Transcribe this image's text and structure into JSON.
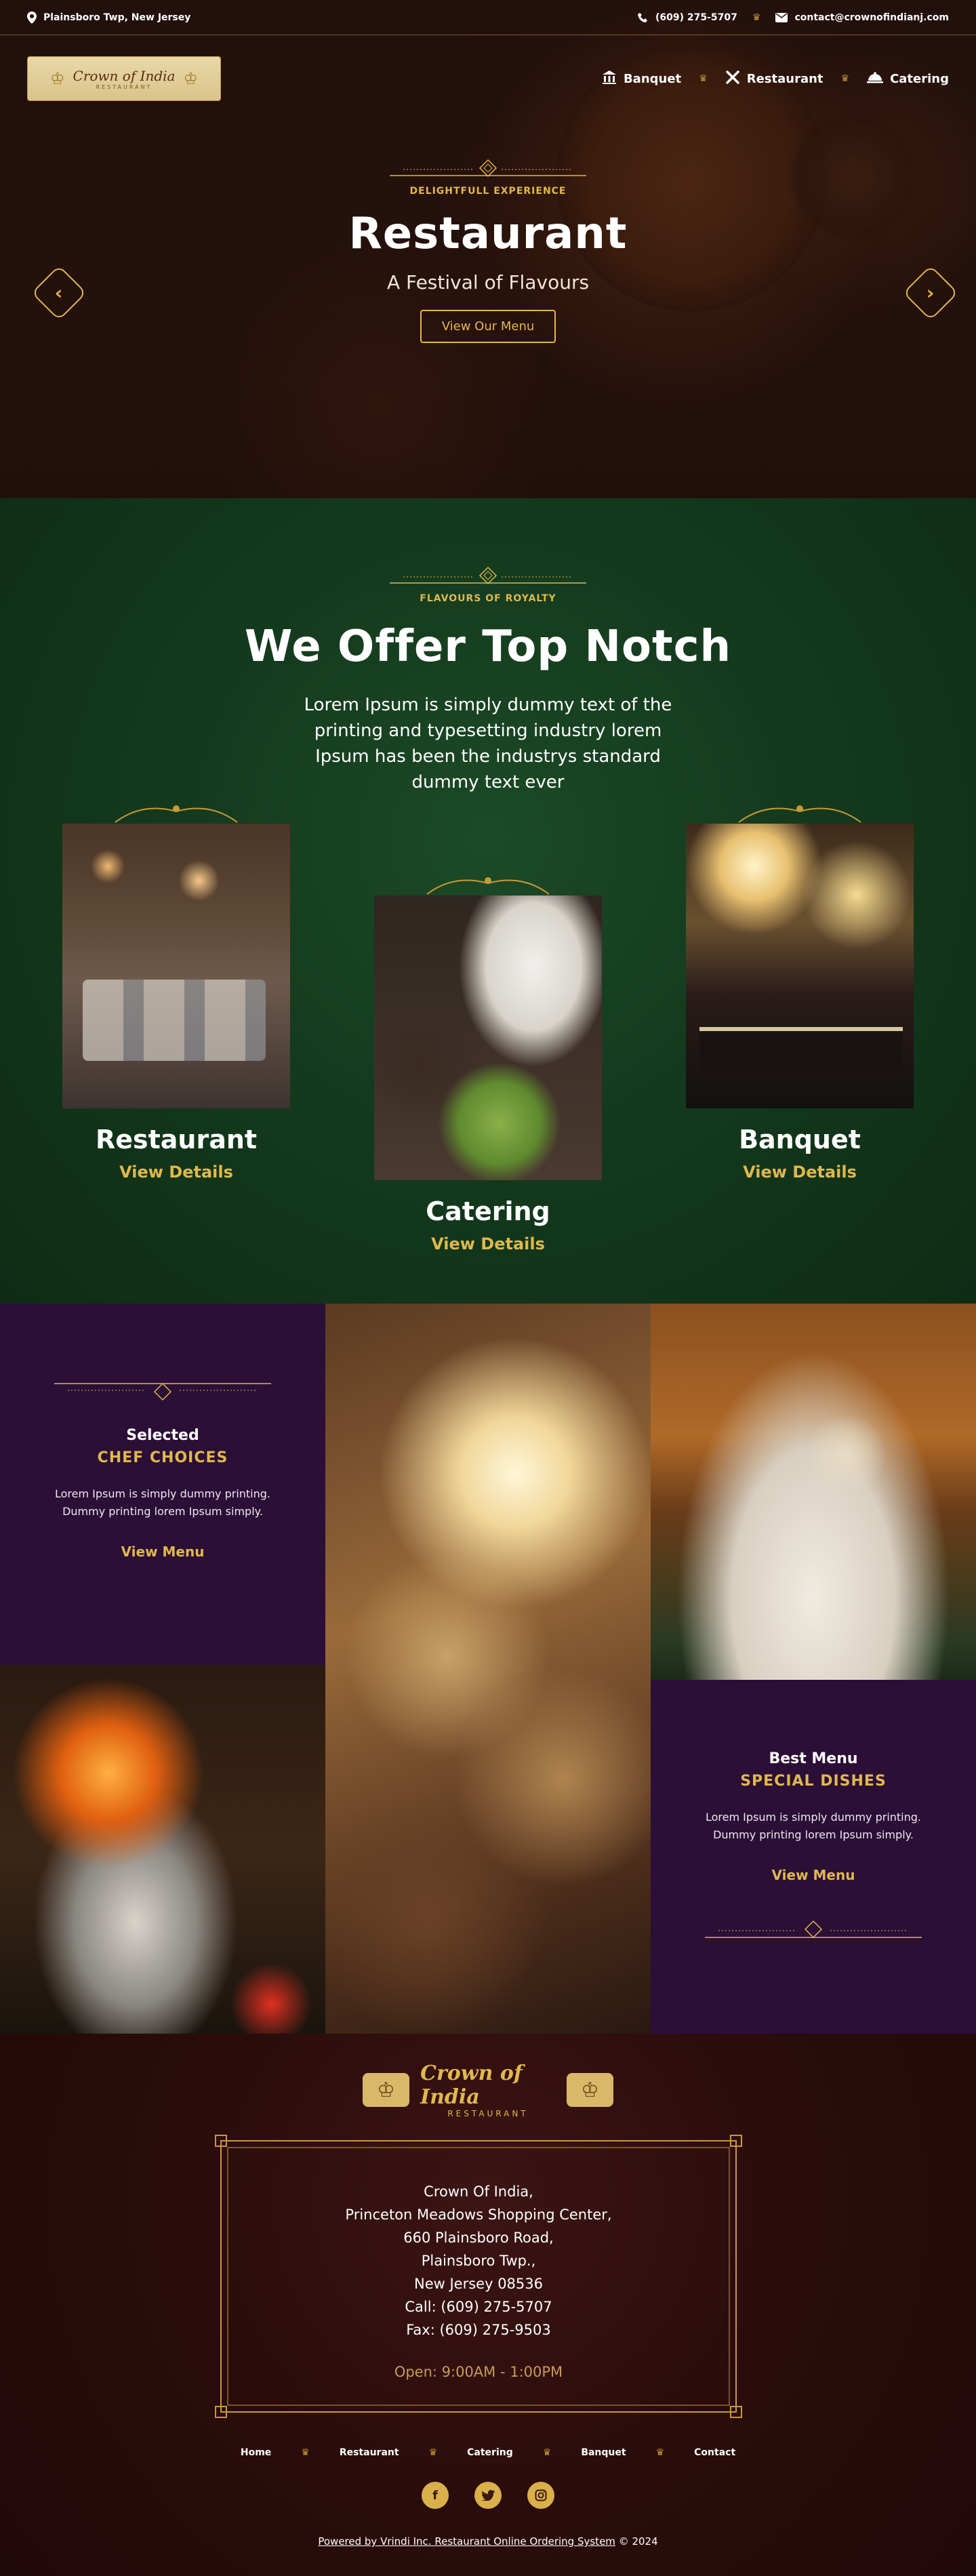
{
  "topbar": {
    "location": "Plainsboro Twp, New Jersey",
    "phone": "(609) 275-5707",
    "email": "contact@crownofindianj.com"
  },
  "logo": {
    "name": "Crown of India",
    "sub": "RESTAURANT"
  },
  "nav": [
    {
      "label": "Banquet",
      "icon": "building-icon"
    },
    {
      "label": "Restaurant",
      "icon": "utensils-icon"
    },
    {
      "label": "Catering",
      "icon": "cloche-icon"
    }
  ],
  "hero": {
    "eyebrow": "DELIGHTFULL EXPERIENCE",
    "title": "Restaurant",
    "subtitle": "A Festival of Flavours",
    "button": "View Our Menu"
  },
  "offer": {
    "eyebrow": "FLAVOURS OF ROYALTY",
    "title": "We Offer Top Notch",
    "description": "Lorem Ipsum is simply dummy text of the printing and typesetting industry lorem Ipsum has been the industrys standard dummy text ever",
    "cards": [
      {
        "title": "Restaurant",
        "link": "View Details"
      },
      {
        "title": "Catering",
        "link": "View Details"
      },
      {
        "title": "Banquet",
        "link": "View Details"
      }
    ]
  },
  "chef": {
    "small": "Selected",
    "title": "CHEF CHOICES",
    "text": "Lorem Ipsum is simply dummy printing. Dummy printing lorem Ipsum simply.",
    "link": "View Menu"
  },
  "special": {
    "small": "Best Menu",
    "title": "SPECIAL DISHES",
    "text": "Lorem Ipsum is simply dummy printing. Dummy printing lorem Ipsum simply.",
    "link": "View Menu"
  },
  "footer": {
    "logo_name": "Crown of India",
    "logo_sub": "RESTAURANT",
    "address": [
      "Crown Of India,",
      "Princeton Meadows Shopping Center,",
      "660 Plainsboro Road,",
      "Plainsboro Twp.,",
      "New Jersey 08536",
      "Call: (609) 275-5707",
      "Fax: (609) 275-9503"
    ],
    "hours": "Open: 9:00AM - 1:00PM",
    "links": [
      "Home",
      "Restaurant",
      "Catering",
      "Banquet",
      "Contact"
    ],
    "social": [
      "facebook-icon",
      "twitter-icon",
      "instagram-icon"
    ],
    "powered": "Powered by Vrindi Inc. Restaurant Online Ordering System",
    "year": "© 2024"
  },
  "colors": {
    "gold": "#e0b84e",
    "green": "#143a1d",
    "purple": "#2b0f36",
    "maroon": "#220909"
  }
}
